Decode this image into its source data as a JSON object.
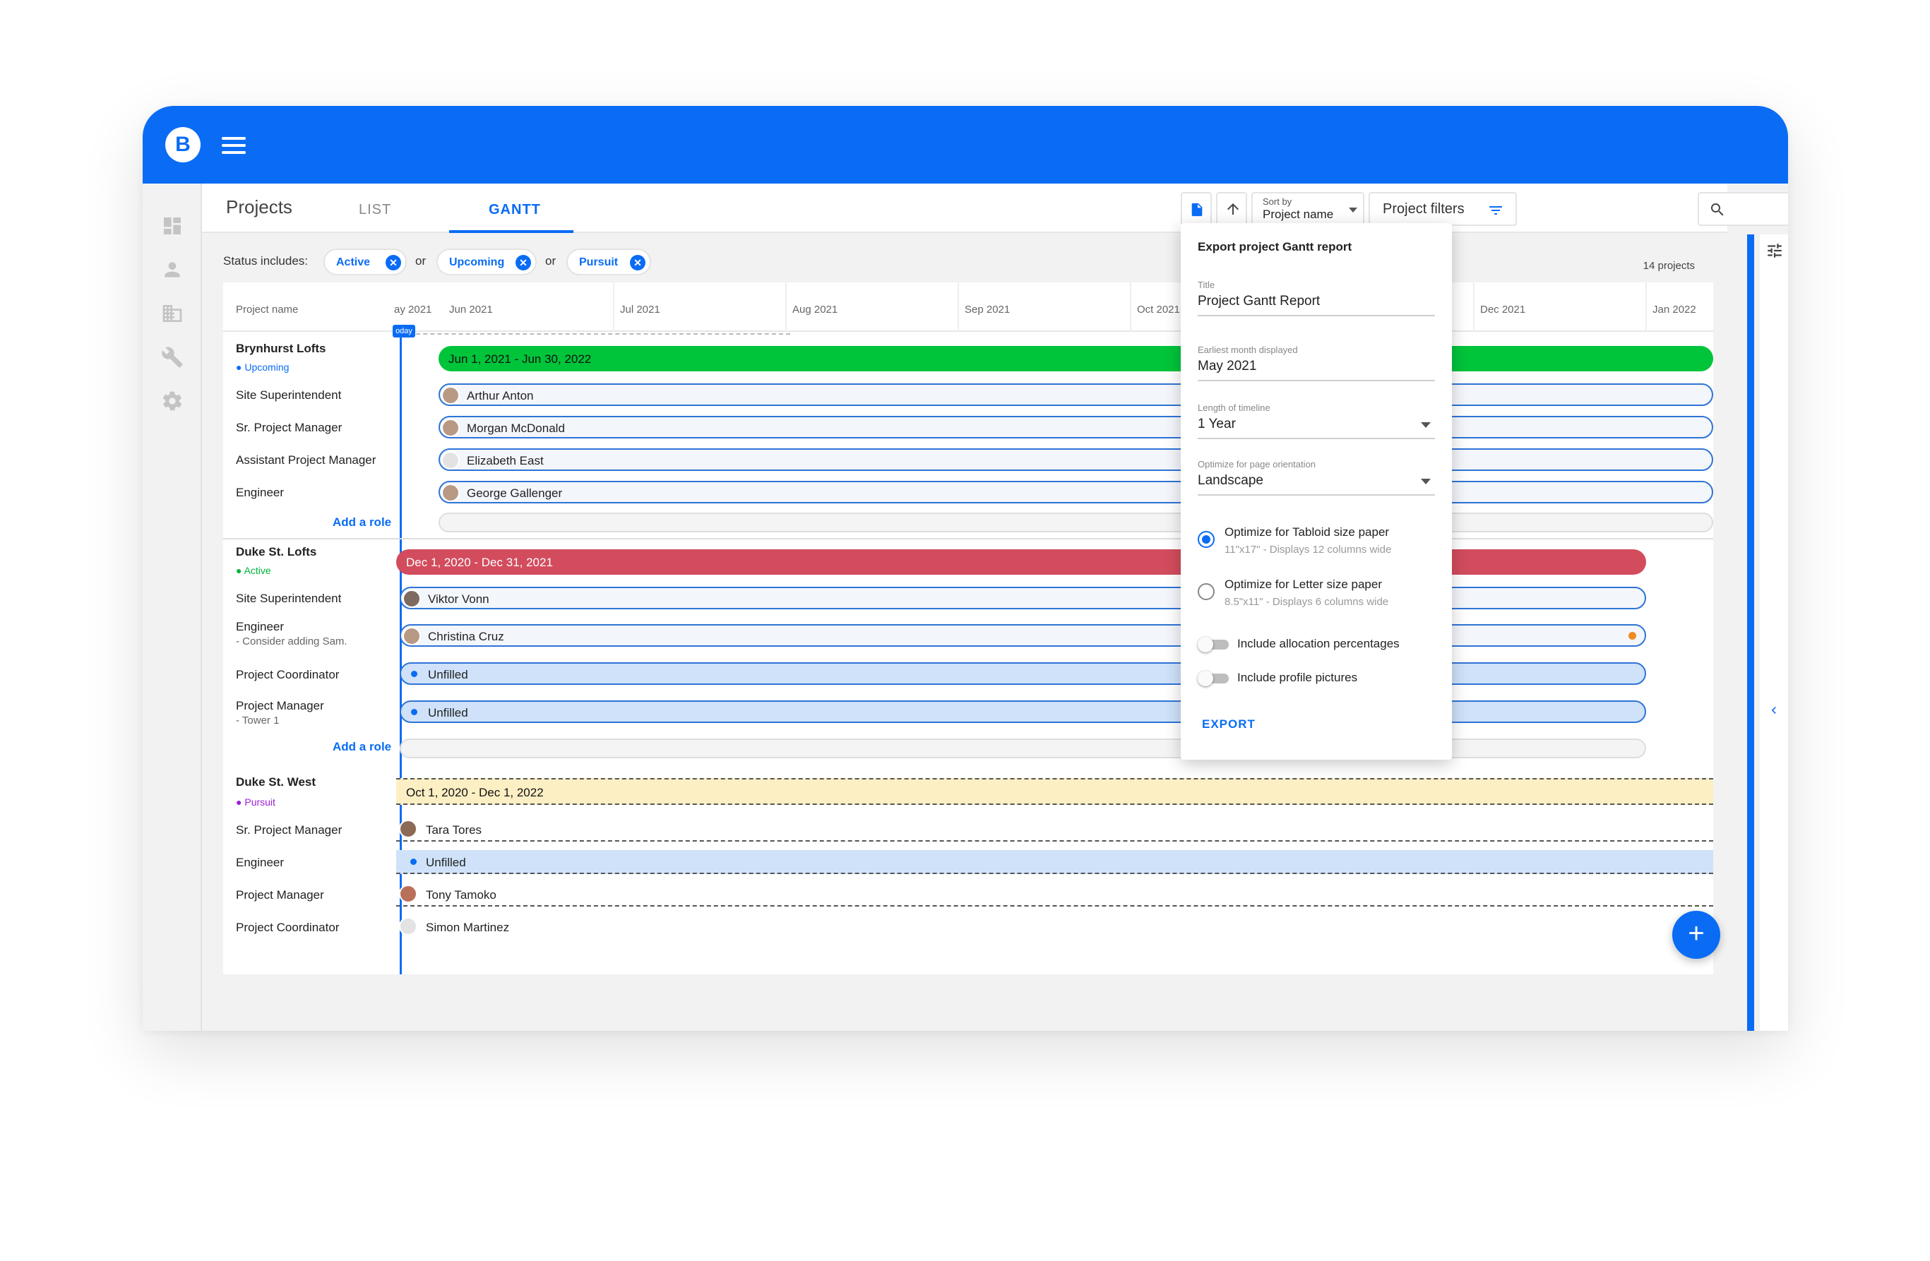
{
  "app": {
    "logo_letter": "B",
    "accent_color": "#0a6cf5"
  },
  "header": {
    "section_title": "Projects",
    "tabs": [
      {
        "label": "LIST"
      },
      {
        "label": "GANTT"
      }
    ]
  },
  "toolbar": {
    "sort_label": "Sort by",
    "sort_value": "Project name",
    "filters_label": "Project filters"
  },
  "status_filter": {
    "label": "Status includes:",
    "chips": [
      {
        "label": "Active"
      },
      {
        "label": "Upcoming"
      },
      {
        "label": "Pursuit"
      }
    ],
    "or_label": "or",
    "count": "14 projects"
  },
  "gantt": {
    "name_column_header": "Project name",
    "months": [
      "ay 2021",
      "Jun 2021",
      "Jul 2021",
      "Aug 2021",
      "Sep 2021",
      "Oct 2021",
      "Dec 2021",
      "Jan 2022"
    ],
    "today_label": "oday",
    "add_role": "Add a role",
    "unfilled": "Unfilled",
    "projects": [
      {
        "name": "Brynhurst Lofts",
        "status": "Upcoming",
        "status_color": "#0a6cf5",
        "range": "Jun 1, 2021 - Jun 30, 2022",
        "bar_color": "#00c43a",
        "roles": [
          {
            "role": "Site Superintendent",
            "person": "Arthur Anton"
          },
          {
            "role": "Sr. Project Manager",
            "person": "Morgan McDonald"
          },
          {
            "role": "Assistant Project Manager",
            "person": "Elizabeth East"
          },
          {
            "role": "Engineer",
            "person": "George Gallenger"
          }
        ]
      },
      {
        "name": "Duke St. Lofts",
        "status": "Active",
        "status_color": "#00b33c",
        "range": "Dec 1, 2020 - Dec 31, 2021",
        "bar_color": "#d24c5d",
        "roles": [
          {
            "role": "Site Superintendent",
            "person": "Viktor Vonn"
          },
          {
            "role": "Engineer",
            "note": "- Consider adding Sam.",
            "person": "Christina Cruz"
          },
          {
            "role": "Project Coordinator",
            "person": "Unfilled"
          },
          {
            "role": "Project Manager",
            "note": "- Tower 1",
            "person": "Unfilled"
          }
        ]
      },
      {
        "name": "Duke St. West",
        "status": "Pursuit",
        "status_color": "#9c1fd6",
        "range": "Oct 1, 2020 - Dec 1, 2022",
        "bar_color": "#fdefc4",
        "roles": [
          {
            "role": "Sr. Project Manager",
            "person": "Tara Tores"
          },
          {
            "role": "Engineer",
            "person": "Unfilled"
          },
          {
            "role": "Project Manager",
            "person": "Tony Tamoko"
          },
          {
            "role": "Project Coordinator",
            "person": "Simon Martinez"
          }
        ]
      }
    ]
  },
  "export_panel": {
    "title": "Export project Gantt report",
    "title_field_label": "Title",
    "title_field_value": "Project Gantt Report",
    "earliest_label": "Earliest month displayed",
    "earliest_value": "May 2021",
    "length_label": "Length of timeline",
    "length_value": "1 Year",
    "orientation_label": "Optimize for page orientation",
    "orientation_value": "Landscape",
    "tabloid_label": "Optimize for Tabloid size paper",
    "tabloid_sub": "11\"x17\" - Displays 12 columns wide",
    "letter_label": "Optimize for Letter size paper",
    "letter_sub": "8.5\"x11\" - Displays 6 columns wide",
    "alloc_label": "Include allocation percentages",
    "pics_label": "Include profile pictures",
    "export_label": "EXPORT"
  }
}
